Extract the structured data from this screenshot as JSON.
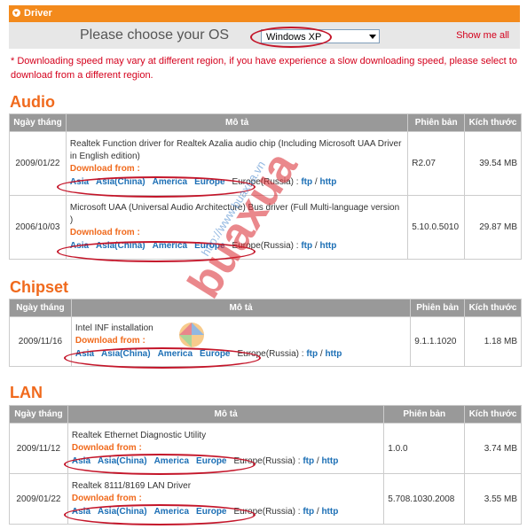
{
  "header": {
    "title": "Driver"
  },
  "os": {
    "label": "Please choose your OS",
    "selected": "Windows XP",
    "show_all": "Show me all"
  },
  "note": "* Downloading speed may vary at different region, if you have experience a slow downloading speed, please select to download from a different region.",
  "columns": {
    "date": "Ngày tháng",
    "desc": "Mô tả",
    "version": "Phiên bản",
    "size": "Kích thước"
  },
  "download_from": "Download from :",
  "mirrors": [
    "Asia",
    "Asia(China)",
    "America",
    "Europe"
  ],
  "mirror_plain": "Europe(Russia) :",
  "ftp": "ftp",
  "http": "http",
  "sections": {
    "audio": {
      "title": "Audio",
      "rows": [
        {
          "date": "2009/01/22",
          "desc": "Realtek Function driver for Realtek Azalia audio chip (Including Microsoft UAA Driver in English edition)",
          "version": "R2.07",
          "size": "39.54 MB"
        },
        {
          "date": "2006/10/03",
          "desc": "Microsoft UAA (Universal Audio Architecture) Bus driver (Full Multi-language version )",
          "version": "5.10.0.5010",
          "size": "29.87 MB"
        }
      ]
    },
    "chipset": {
      "title": "Chipset",
      "rows": [
        {
          "date": "2009/11/16",
          "desc": "Intel INF installation",
          "version": "9.1.1.1020",
          "size": "1.18 MB"
        }
      ]
    },
    "lan": {
      "title": "LAN",
      "rows": [
        {
          "date": "2009/11/12",
          "desc": "Realtek Ethernet Diagnostic Utility",
          "version": "1.0.0",
          "size": "3.74 MB"
        },
        {
          "date": "2009/01/22",
          "desc": "Realtek 8111/8169 LAN Driver",
          "version": "5.708.1030.2008",
          "size": "3.55 MB"
        }
      ]
    }
  },
  "watermark": {
    "text": "buaxua",
    "url": "http://www.buaxua.vn"
  }
}
